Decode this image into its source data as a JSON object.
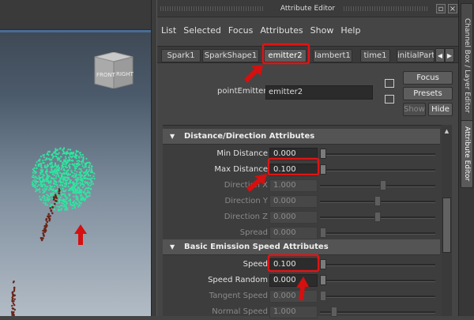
{
  "viewport": {
    "viewcube_front": "FRONT",
    "viewcube_right": "RIGHT"
  },
  "attribute_editor": {
    "title": "Attribute Editor",
    "menu": [
      "List",
      "Selected",
      "Focus",
      "Attributes",
      "Show",
      "Help"
    ],
    "tabs": [
      "Spark1",
      "SparkShape1",
      "emitter2",
      "lambert1",
      "time1",
      "initialPart"
    ],
    "active_tab": "emitter2",
    "node_type_label": "pointEmitter:",
    "node_name": "emitter2",
    "buttons": {
      "focus": "Focus",
      "presets": "Presets",
      "show": "Show",
      "hide": "Hide"
    },
    "sections": [
      {
        "title": "Distance/Direction Attributes",
        "rows": [
          {
            "label": "Min Distance",
            "value": "0.000",
            "enabled": true,
            "slider": 0.0
          },
          {
            "label": "Max Distance",
            "value": "0.100",
            "enabled": true,
            "slider": 0.0
          },
          {
            "label": "Direction X",
            "value": "1.000",
            "enabled": false,
            "slider": 0.55
          },
          {
            "label": "Direction Y",
            "value": "0.000",
            "enabled": false,
            "slider": 0.5
          },
          {
            "label": "Direction Z",
            "value": "0.000",
            "enabled": false,
            "slider": 0.5
          },
          {
            "label": "Spread",
            "value": "0.000",
            "enabled": false,
            "slider": 0.0
          }
        ]
      },
      {
        "title": "Basic Emission Speed Attributes",
        "rows": [
          {
            "label": "Speed",
            "value": "0.100",
            "enabled": true,
            "slider": 0.0
          },
          {
            "label": "Speed Random",
            "value": "0.000",
            "enabled": true,
            "slider": 0.0
          },
          {
            "label": "Tangent Speed",
            "value": "0.000",
            "enabled": false,
            "slider": 0.0
          },
          {
            "label": "Normal Speed",
            "value": "1.000",
            "enabled": false,
            "slider": 0.1
          }
        ]
      }
    ]
  },
  "side_tabs": [
    "Channel Box / Layer Editor",
    "Attribute Editor"
  ],
  "colors": {
    "highlight_red": "#e01414",
    "particles": "#2ee6a0"
  }
}
